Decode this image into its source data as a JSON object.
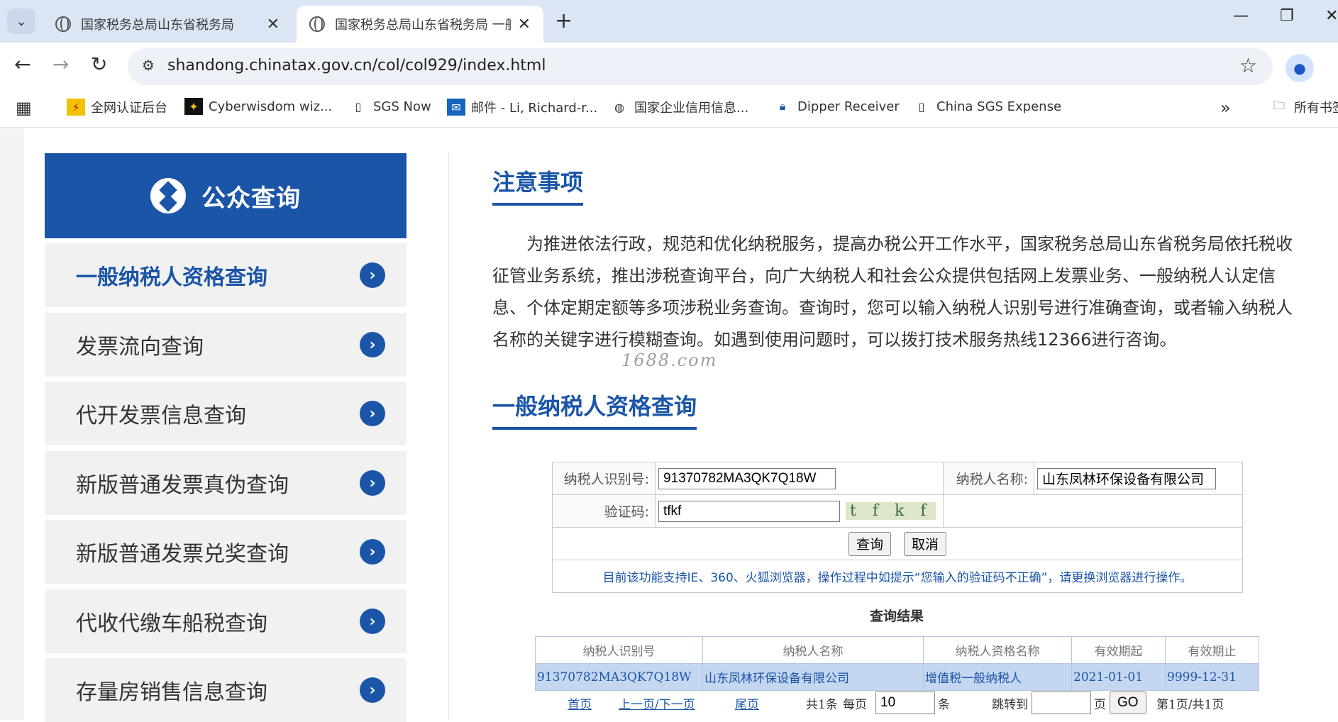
{
  "browser": {
    "tabs": [
      {
        "title": "国家税务总局山东省税务局",
        "active": false
      },
      {
        "title": "国家税务总局山东省税务局 一般",
        "active": true
      }
    ],
    "url": "shandong.chinatax.gov.cn/col/col929/index.html",
    "bookmarks": [
      "全网认证后台",
      "Cyberwisdom wiz...",
      "SGS Now",
      "邮件 - Li, Richard-r...",
      "国家企业信用信息...",
      "Dipper Receiver",
      "China SGS Expense",
      "所有书签"
    ]
  },
  "sidebar": {
    "title": "公众查询",
    "items": [
      {
        "label": "一般纳税人资格查询",
        "active": true
      },
      {
        "label": "发票流向查询"
      },
      {
        "label": "代开发票信息查询"
      },
      {
        "label": "新版普通发票真伪查询"
      },
      {
        "label": "新版普通发票兑奖查询"
      },
      {
        "label": "代收代缴车船税查询"
      },
      {
        "label": "存量房销售信息查询"
      }
    ]
  },
  "notice": {
    "title": "注意事项",
    "text": "为推进依法行政，规范和优化纳税服务，提高办税公开工作水平，国家税务总局山东省税务局依托税收征管业务系统，推出涉税查询平台，向广大纳税人和社会公众提供包括网上发票业务、一般纳税人认定信息、个体定期定额等多项涉税业务查询。查询时，您可以输入纳税人识别号进行准确查询，或者输入纳税人名称的关键字进行模糊查询。如遇到使用问题时，可以拨打技术服务热线12366进行咨询。"
  },
  "watermark": "1688.com",
  "query": {
    "title": "一般纳税人资格查询",
    "taxid_label": "纳税人识别号:",
    "taxid_value": "91370782MA3QK7Q18W",
    "name_label": "纳税人名称:",
    "name_value": "山东凤林环保设备有限公司",
    "captcha_label": "验证码:",
    "captcha_value": "tfkf",
    "captcha_image_text": "t f k f",
    "search_button": "查询",
    "cancel_button": "取消",
    "tip": "目前该功能支持IE、360、火狐浏览器，操作过程中如提示“您输入的验证码不正确”，请更换浏览器进行操作。"
  },
  "results": {
    "title": "查询结果",
    "columns": [
      "纳税人识别号",
      "纳税人名称",
      "纳税人资格名称",
      "有效期起",
      "有效期止"
    ],
    "rows": [
      [
        "91370782MA3QK7Q18W",
        "山东凤林环保设备有限公司",
        "增值税一般纳税人",
        "2021-01-01",
        "9999-12-31"
      ]
    ]
  },
  "pager": {
    "first": "首页",
    "prev_next": "上一页/下一页",
    "last": "尾页",
    "total": "共1条",
    "per_page_label": "每页",
    "per_page_value": "10",
    "per_page_unit": "条",
    "jump_label": "跳转到",
    "jump_unit": "页",
    "go": "GO",
    "page_info": "第1页/共1页"
  }
}
